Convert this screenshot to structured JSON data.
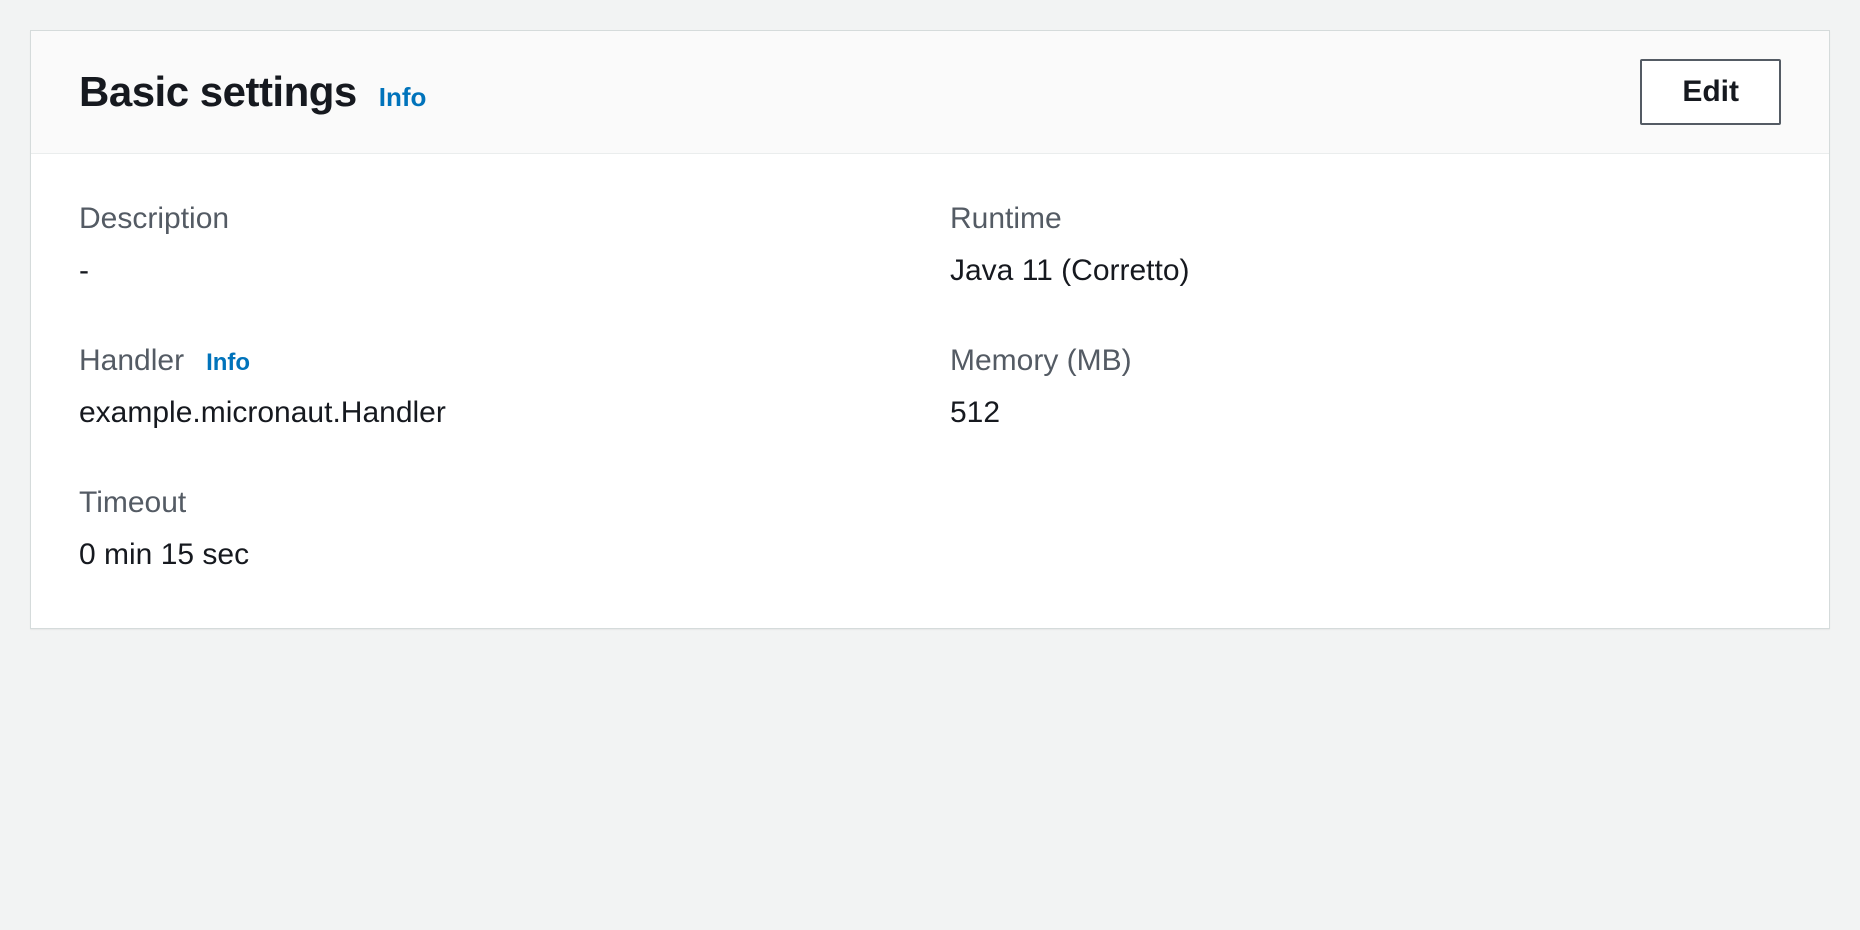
{
  "panel": {
    "title": "Basic settings",
    "info_label": "Info",
    "edit_label": "Edit"
  },
  "fields": {
    "description": {
      "label": "Description",
      "value": "-"
    },
    "runtime": {
      "label": "Runtime",
      "value": "Java 11 (Corretto)"
    },
    "handler": {
      "label": "Handler",
      "info_label": "Info",
      "value": "example.micronaut.Handler"
    },
    "memory": {
      "label": "Memory (MB)",
      "value": "512"
    },
    "timeout": {
      "label": "Timeout",
      "value": "0 min  15 sec"
    }
  }
}
